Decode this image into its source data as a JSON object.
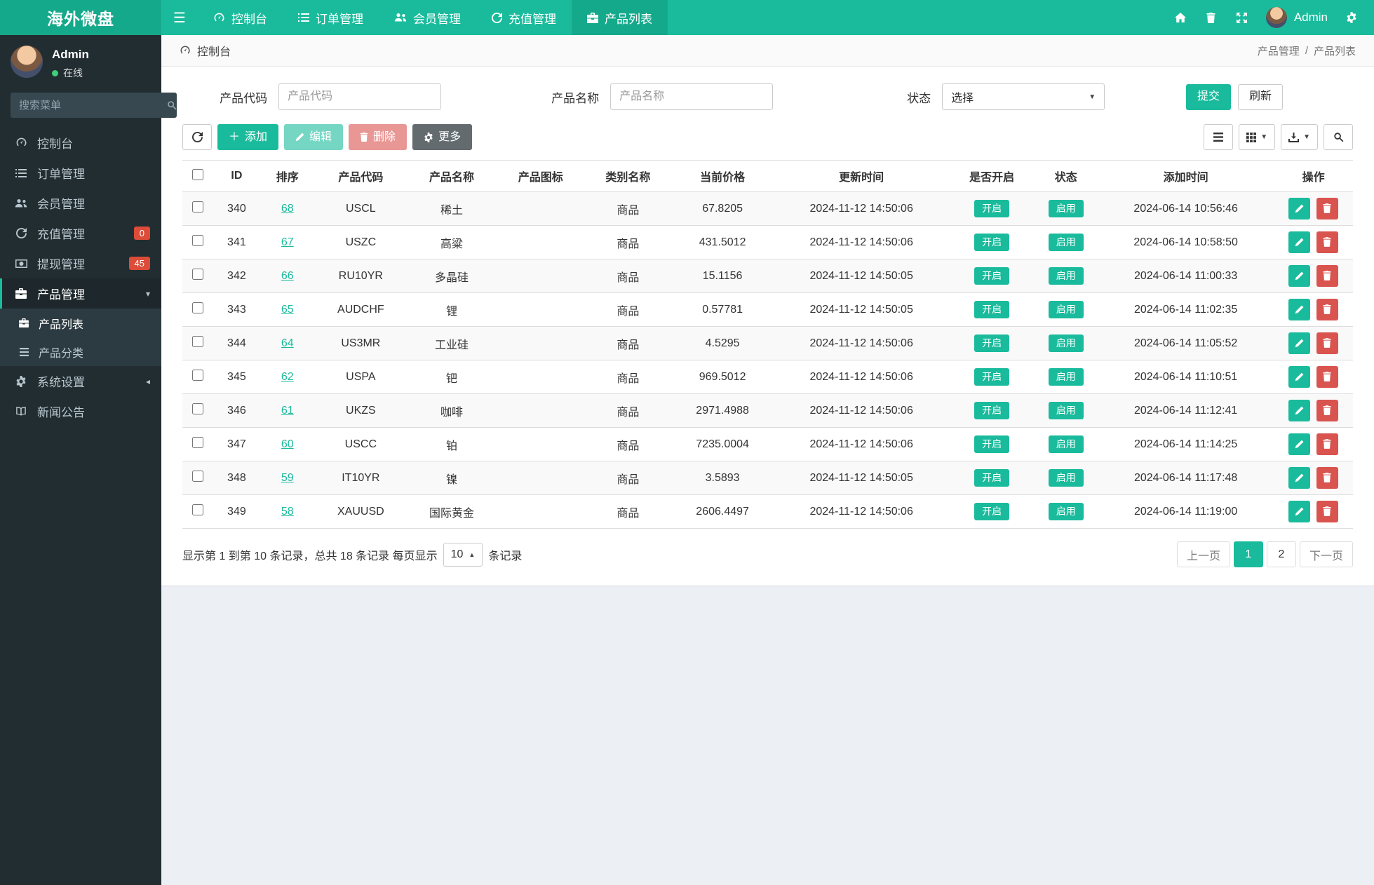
{
  "brand": "海外微盘",
  "colors": {
    "accent": "#1ABB9C",
    "accent_dark": "#15A98B",
    "danger": "#D9534F",
    "badge_red": "#DD4B39",
    "sidebar_bg": "#222D32"
  },
  "navbar": {
    "menu": [
      {
        "label": "控制台"
      },
      {
        "label": "订单管理"
      },
      {
        "label": "会员管理"
      },
      {
        "label": "充值管理"
      },
      {
        "label": "产品列表"
      }
    ],
    "username": "Admin"
  },
  "sidebar": {
    "user_name": "Admin",
    "user_status": "在线",
    "search_placeholder": "搜索菜单",
    "items": [
      {
        "label": "控制台"
      },
      {
        "label": "订单管理"
      },
      {
        "label": "会员管理"
      },
      {
        "label": "充值管理",
        "badge": "0"
      },
      {
        "label": "提现管理",
        "badge": "45"
      },
      {
        "label": "产品管理"
      },
      {
        "label": "系统设置"
      },
      {
        "label": "新闻公告"
      }
    ],
    "submenu": [
      {
        "label": "产品列表"
      },
      {
        "label": "产品分类"
      }
    ]
  },
  "breadcrumb": {
    "section": "控制台",
    "parent": "产品管理",
    "current": "产品列表"
  },
  "filters": {
    "code_label": "产品代码",
    "code_placeholder": "产品代码",
    "name_label": "产品名称",
    "name_placeholder": "产品名称",
    "status_label": "状态",
    "status_value": "选择",
    "submit_label": "提交",
    "refresh_label": "刷新"
  },
  "toolbar": {
    "add_label": "添加",
    "edit_label": "编辑",
    "delete_label": "删除",
    "more_label": "更多"
  },
  "table": {
    "columns": [
      "ID",
      "排序",
      "产品代码",
      "产品名称",
      "产品图标",
      "类别名称",
      "当前价格",
      "更新时间",
      "是否开启",
      "状态",
      "添加时间",
      "操作"
    ],
    "open_badge": "开启",
    "status_badge": "启用",
    "rows": [
      {
        "id": "340",
        "sort": "68",
        "code": "USCL",
        "name": "稀土",
        "category": "商品",
        "price": "67.8205",
        "updated": "2024-11-12 14:50:06",
        "added": "2024-06-14 10:56:46"
      },
      {
        "id": "341",
        "sort": "67",
        "code": "USZC",
        "name": "高粱",
        "category": "商品",
        "price": "431.5012",
        "updated": "2024-11-12 14:50:06",
        "added": "2024-06-14 10:58:50"
      },
      {
        "id": "342",
        "sort": "66",
        "code": "RU10YR",
        "name": "多晶硅",
        "category": "商品",
        "price": "15.1156",
        "updated": "2024-11-12 14:50:05",
        "added": "2024-06-14 11:00:33"
      },
      {
        "id": "343",
        "sort": "65",
        "code": "AUDCHF",
        "name": "锂",
        "category": "商品",
        "price": "0.57781",
        "updated": "2024-11-12 14:50:05",
        "added": "2024-06-14 11:02:35"
      },
      {
        "id": "344",
        "sort": "64",
        "code": "US3MR",
        "name": "工业硅",
        "category": "商品",
        "price": "4.5295",
        "updated": "2024-11-12 14:50:06",
        "added": "2024-06-14 11:05:52"
      },
      {
        "id": "345",
        "sort": "62",
        "code": "USPA",
        "name": "钯",
        "category": "商品",
        "price": "969.5012",
        "updated": "2024-11-12 14:50:06",
        "added": "2024-06-14 11:10:51"
      },
      {
        "id": "346",
        "sort": "61",
        "code": "UKZS",
        "name": "咖啡",
        "category": "商品",
        "price": "2971.4988",
        "updated": "2024-11-12 14:50:06",
        "added": "2024-06-14 11:12:41"
      },
      {
        "id": "347",
        "sort": "60",
        "code": "USCC",
        "name": "铂",
        "category": "商品",
        "price": "7235.0004",
        "updated": "2024-11-12 14:50:06",
        "added": "2024-06-14 11:14:25"
      },
      {
        "id": "348",
        "sort": "59",
        "code": "IT10YR",
        "name": "镍",
        "category": "商品",
        "price": "3.5893",
        "updated": "2024-11-12 14:50:05",
        "added": "2024-06-14 11:17:48"
      },
      {
        "id": "349",
        "sort": "58",
        "code": "XAUUSD",
        "name": "国际黄金",
        "category": "商品",
        "price": "2606.4497",
        "updated": "2024-11-12 14:50:06",
        "added": "2024-06-14 11:19:00"
      }
    ]
  },
  "footer": {
    "summary_prefix": "显示第 1 到第 10 条记录，总共 18 条记录 每页显示",
    "page_size": "10",
    "summary_suffix": "条记录",
    "prev": "上一页",
    "page_1": "1",
    "page_2": "2",
    "next": "下一页"
  }
}
